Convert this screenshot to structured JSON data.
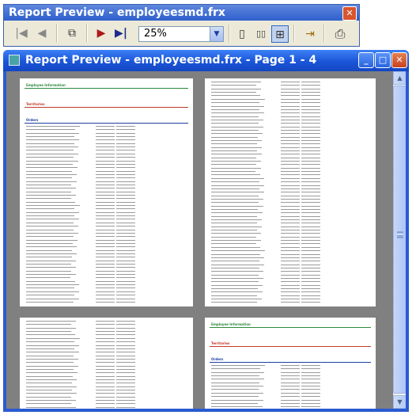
{
  "toolbar_window": {
    "title": "Report Preview - employeesmd.frx",
    "close_label": "✕",
    "zoom": {
      "value": "25%",
      "arrow": "▼"
    },
    "buttons": {
      "first": "|◀",
      "prev": "◀",
      "copy": "⧉",
      "next": "▶",
      "last": "▶|",
      "one_page": "▯",
      "two_pages": "▯▯",
      "four_pages": "⊞",
      "go_to_page": "⇥",
      "print": "⎙"
    }
  },
  "preview_window": {
    "title": "Report Preview - employeesmd.frx - Page 1 - 4",
    "buttons": {
      "minimize": "_",
      "maximize": "□",
      "close": "✕"
    },
    "scroll": {
      "up": "▲",
      "down": "▼"
    }
  },
  "pages": [
    {
      "sections": [
        "Employee Information",
        "Territories",
        "Orders"
      ]
    },
    {
      "sections": []
    },
    {
      "sections": []
    },
    {
      "sections": [
        "Employee Information",
        "Territories",
        "Orders"
      ]
    }
  ],
  "colors": {
    "section_green": "#2b8a3a",
    "section_red": "#c0392b",
    "section_blue": "#1f3fa0"
  }
}
